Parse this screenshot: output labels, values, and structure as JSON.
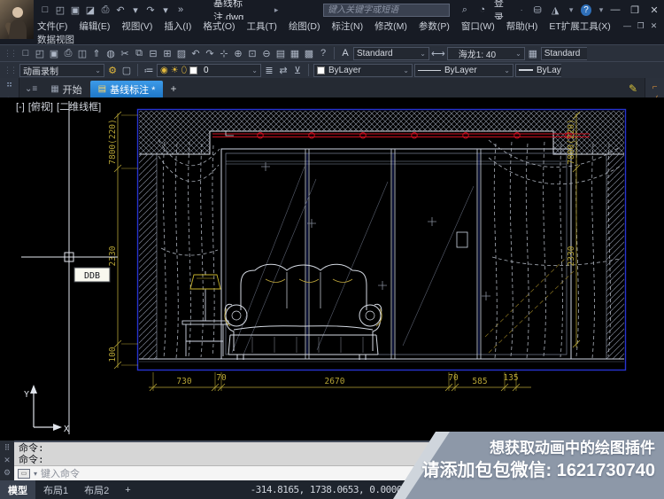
{
  "window": {
    "filename": "基线标注.dwg",
    "search_placeholder": "键入关键字或短语",
    "login_label": "登录",
    "help_glyph": "?",
    "minimize": "—",
    "restore": "❐",
    "close": "✕",
    "menu_items": [
      "文件(F)",
      "编辑(E)",
      "视图(V)",
      "插入(I)",
      "格式(O)",
      "工具(T)",
      "绘图(D)",
      "标注(N)",
      "修改(M)",
      "参数(P)",
      "窗口(W)",
      "帮助(H)",
      "ET扩展工具(X)"
    ],
    "menu_row2": "数据视图",
    "quick_access": [
      {
        "name": "new-icon",
        "glyph": "□"
      },
      {
        "name": "open-icon",
        "glyph": "◰"
      },
      {
        "name": "save-icon",
        "glyph": "▣"
      },
      {
        "name": "save-as-icon",
        "glyph": "◪"
      },
      {
        "name": "print-icon",
        "glyph": "⎙"
      },
      {
        "name": "undo-icon",
        "glyph": "↶"
      },
      {
        "name": "undo-dropdown-icon",
        "glyph": "▾"
      },
      {
        "name": "redo-icon",
        "glyph": "↷"
      },
      {
        "name": "redo-dropdown-icon",
        "glyph": "▾"
      },
      {
        "name": "more-commands-icon",
        "glyph": "»"
      }
    ]
  },
  "toolbars": {
    "standard_icons": [
      {
        "name": "new-icon",
        "glyph": "□"
      },
      {
        "name": "open-icon",
        "glyph": "◰"
      },
      {
        "name": "save-icon",
        "glyph": "▣"
      },
      {
        "name": "print-icon",
        "glyph": "⎙"
      },
      {
        "name": "print-preview-icon",
        "glyph": "◫"
      },
      {
        "name": "publish-icon",
        "glyph": "⇑"
      },
      {
        "name": "web-icon",
        "glyph": "◍"
      },
      {
        "name": "cut-icon",
        "glyph": "✂"
      },
      {
        "name": "copy-icon",
        "glyph": "⧉"
      },
      {
        "name": "paste-icon",
        "glyph": "⊟"
      },
      {
        "name": "copy-base-icon",
        "glyph": "⊞"
      },
      {
        "name": "match-properties-icon",
        "glyph": "▨"
      },
      {
        "name": "undo-icon",
        "glyph": "↶"
      },
      {
        "name": "redo-icon",
        "glyph": "↷"
      },
      {
        "name": "pan-icon",
        "glyph": "⊹"
      },
      {
        "name": "zoom-realtime-icon",
        "glyph": "⊕"
      },
      {
        "name": "zoom-window-icon",
        "glyph": "⊡"
      },
      {
        "name": "zoom-previous-icon",
        "glyph": "⊖"
      },
      {
        "name": "properties-icon",
        "glyph": "▤"
      },
      {
        "name": "designcenter-icon",
        "glyph": "▦"
      },
      {
        "name": "calculator-icon",
        "glyph": "▩"
      },
      {
        "name": "help-icon",
        "glyph": "?"
      }
    ],
    "text_style_label": "Standard",
    "dim_style_label": "海龙1: 40",
    "table_style_label": "Standard",
    "animation_combo": "动画录制",
    "layer_name": "0",
    "layer_tool_icons": [
      {
        "name": "layer-states-icon",
        "glyph": "≣"
      },
      {
        "name": "layer-previous-icon",
        "glyph": "⇄"
      },
      {
        "name": "layer-isolate-icon",
        "glyph": "⊻"
      }
    ],
    "color_label": "ByLayer",
    "linetype_label": "ByLayer",
    "lineweight_label": "ByLayer"
  },
  "tabs": {
    "start": "开始",
    "drawing": "基线标注 *",
    "add": "+"
  },
  "viewport": {
    "controls": "[-]",
    "view": "[俯视]",
    "visual_style": "[二维线框]"
  },
  "left_toolbar_icons": [
    {
      "name": "grips-icon",
      "glyph": "⠛"
    },
    {
      "name": "erase-icon",
      "glyph": "✎"
    },
    {
      "name": "copy-icon",
      "glyph": "◎"
    },
    {
      "name": "mirror-icon",
      "glyph": "◭"
    },
    {
      "name": "offset-icon",
      "glyph": "∥"
    },
    {
      "name": "array-icon",
      "glyph": "▦"
    },
    {
      "name": "move-icon",
      "glyph": "↔"
    },
    {
      "name": "rotate-icon",
      "glyph": "↻"
    },
    {
      "name": "scale-icon",
      "glyph": "◱"
    },
    {
      "name": "stretch-icon",
      "glyph": "↗"
    },
    {
      "name": "trim-icon",
      "glyph": "✂"
    },
    {
      "name": "extend-icon",
      "glyph": "→"
    },
    {
      "name": "break-point-icon",
      "glyph": "∤"
    },
    {
      "name": "break-icon",
      "glyph": "⌐"
    },
    {
      "name": "join-icon",
      "glyph": "∪"
    },
    {
      "name": "chamfer-icon",
      "glyph": "∠"
    },
    {
      "name": "fillet-icon",
      "glyph": "⌒"
    },
    {
      "name": "blend-icon",
      "glyph": "∿"
    },
    {
      "name": "explode-icon",
      "glyph": "✳"
    }
  ],
  "right_toolbar_icons": [
    {
      "name": "snap-from-icon",
      "glyph": "⌐"
    },
    {
      "name": "snap-endpoint-icon",
      "glyph": "╱"
    },
    {
      "name": "snap-midpoint-icon",
      "glyph": "∕"
    },
    {
      "name": "snap-intersection-icon",
      "glyph": "╳"
    },
    {
      "name": "snap-apparent-icon",
      "glyph": "✕"
    },
    {
      "name": "snap-extension-icon",
      "glyph": "≡"
    },
    {
      "name": "snap-center-icon",
      "glyph": "⊙"
    },
    {
      "name": "snap-quadrant-icon",
      "glyph": "◇"
    },
    {
      "name": "snap-tangent-icon",
      "glyph": "○"
    },
    {
      "name": "snap-perpendicular-icon",
      "glyph": "⊥"
    },
    {
      "name": "snap-parallel-icon",
      "glyph": "∥"
    },
    {
      "name": "snap-insert-icon",
      "glyph": "▣"
    },
    {
      "name": "snap-node-icon",
      "glyph": "∘"
    },
    {
      "name": "snap-nearest-icon",
      "glyph": "▫"
    },
    {
      "name": "snap-none-icon",
      "glyph": "⊘"
    },
    {
      "name": "snap-settings-icon",
      "glyph": "☷"
    }
  ],
  "drawing": {
    "tooltip": "DDB",
    "dims": {
      "left": [
        "7800(220)",
        "2330",
        "100"
      ],
      "right": [
        "7800(220)",
        "2330"
      ],
      "bottom": [
        "730",
        "70",
        "2670",
        "70",
        "585",
        "135"
      ]
    },
    "ucs": {
      "x": "X",
      "y": "Y"
    }
  },
  "command": {
    "history_line1": "命令:",
    "history_line2": "命令:",
    "placeholder": "键入命令"
  },
  "statusbar": {
    "model_tab": "模型",
    "layout1_tab": "布局1",
    "layout2_tab": "布局2",
    "add_tab": "+",
    "coordinates": "-314.8165, 1738.0653, 0.0000",
    "model_button": "模型"
  },
  "watermark": {
    "line1": "想获取动画中的绘图插件",
    "line2": "请添加包包微信: 1621730740"
  },
  "colors": {
    "accent_blue": "#1f78c8",
    "dim_yellow": "#b5a335",
    "track_red": "#cf1020",
    "border_blue": "#2633d0"
  }
}
